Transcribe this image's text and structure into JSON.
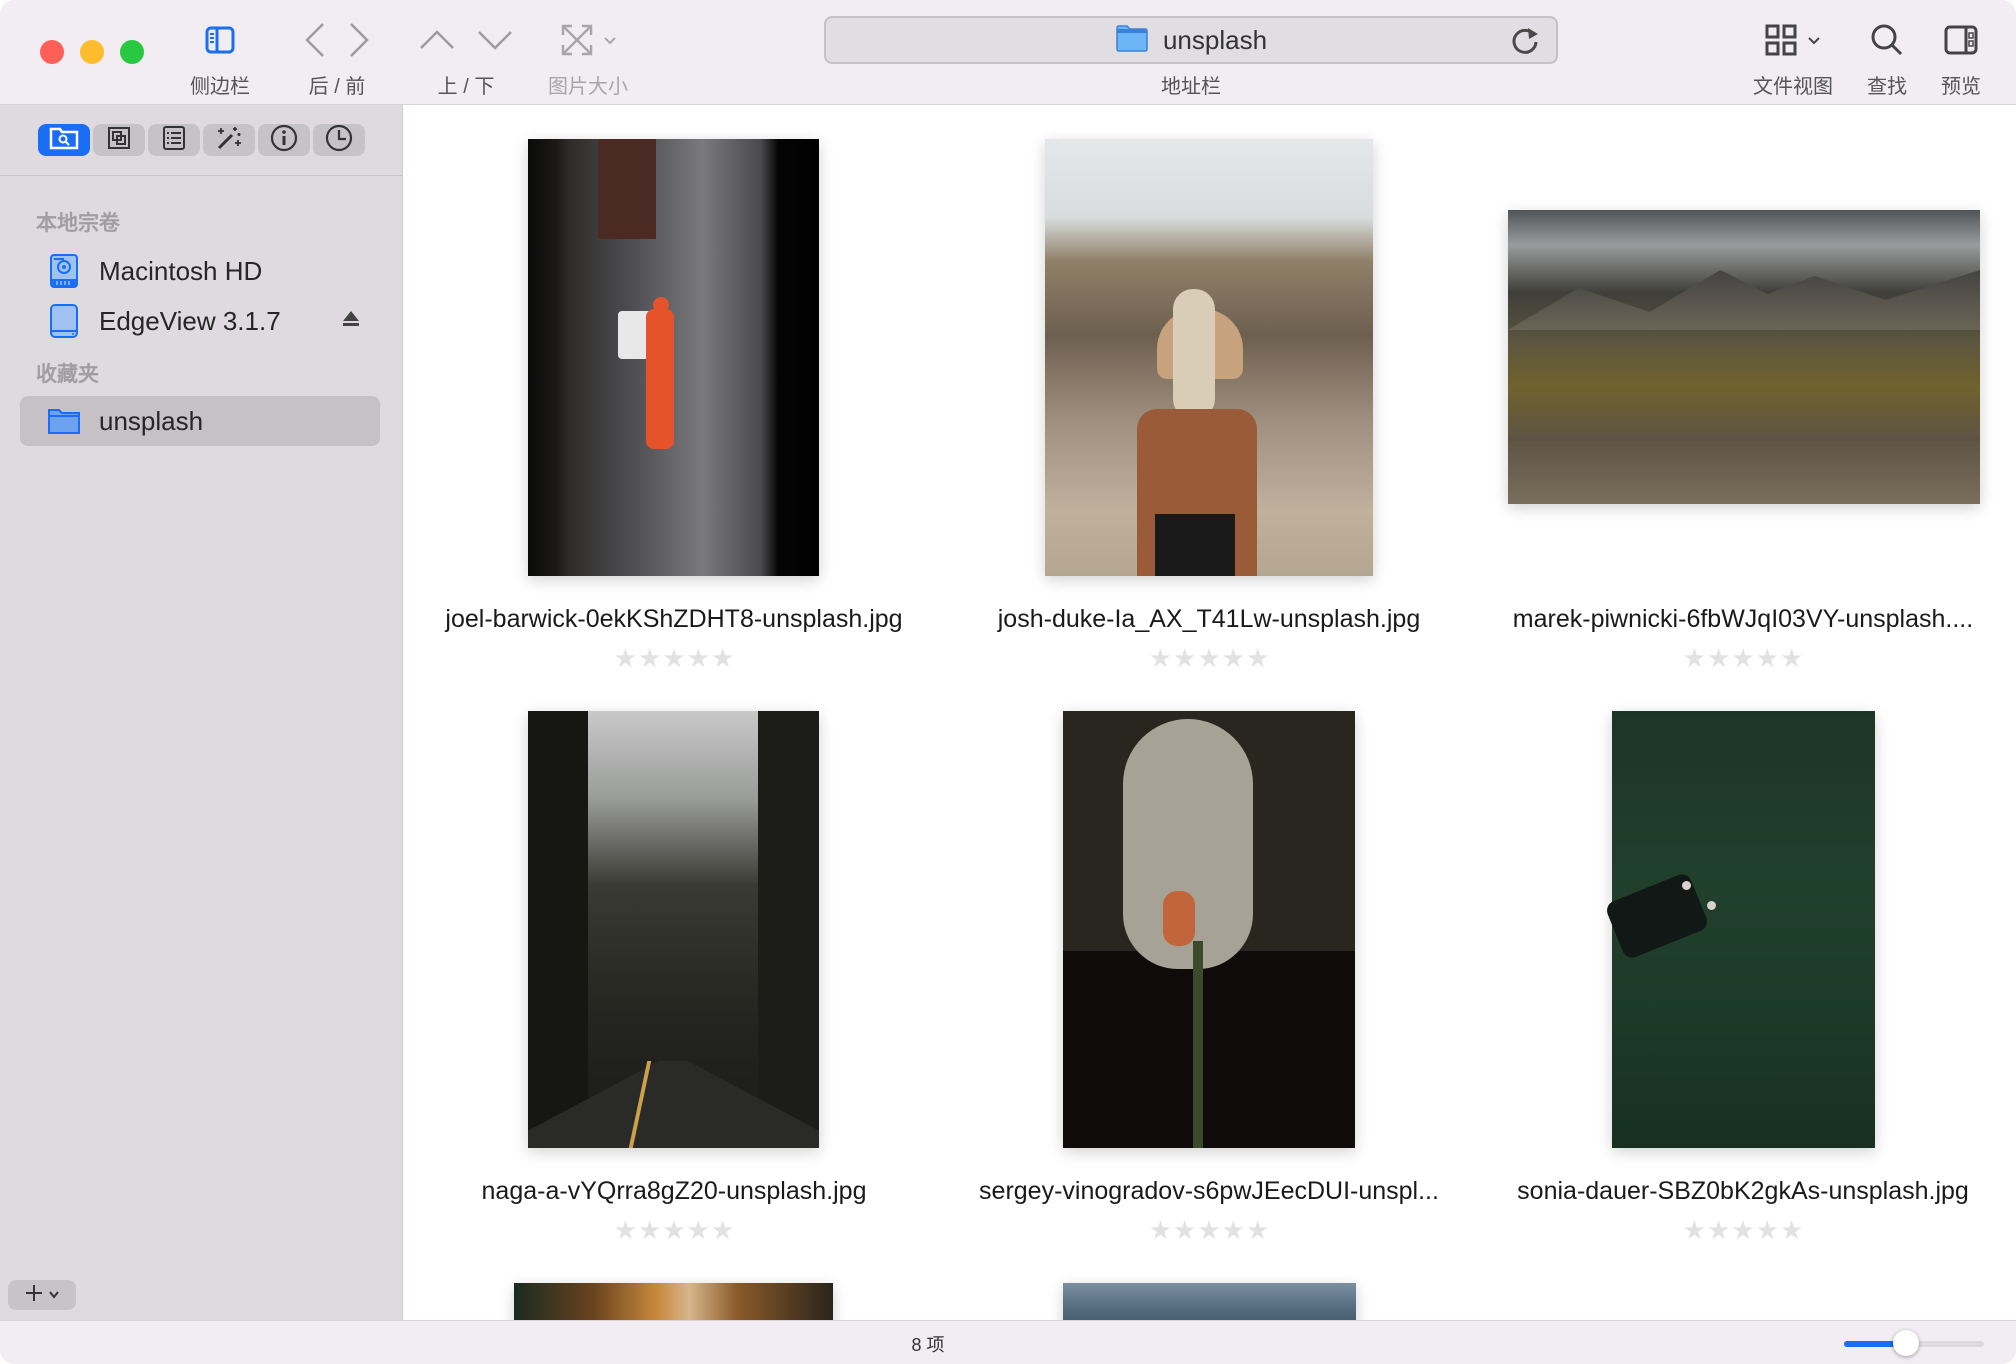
{
  "window": {
    "traffic_lights": {
      "close": "#fe5f57",
      "minimize": "#febc2e",
      "zoom": "#28c840"
    }
  },
  "toolbar": {
    "sidebar_label": "侧边栏",
    "back_forward_label": "后 / 前",
    "up_down_label": "上 / 下",
    "image_size_label": "图片大小",
    "address": {
      "path": "unsplash",
      "label": "地址栏"
    },
    "file_view_label": "文件视图",
    "find_label": "查找",
    "preview_label": "预览"
  },
  "sidebar": {
    "segments": [
      {
        "icon": "folder-search-icon",
        "active": true
      },
      {
        "icon": "layers-icon",
        "active": false
      },
      {
        "icon": "list-icon",
        "active": false
      },
      {
        "icon": "magic-wand-icon",
        "active": false
      },
      {
        "icon": "info-icon",
        "active": false
      },
      {
        "icon": "clock-icon",
        "active": false
      }
    ],
    "sections": [
      {
        "title": "本地宗卷",
        "items": [
          {
            "label": "Macintosh HD",
            "icon": "internal-drive-icon"
          },
          {
            "label": "EdgeView 3.1.7",
            "icon": "external-drive-icon",
            "ejectable": true
          }
        ]
      },
      {
        "title": "收藏夹",
        "items": [
          {
            "label": "unsplash",
            "icon": "folder-icon",
            "selected": true
          }
        ]
      }
    ],
    "add_button": "+"
  },
  "files": [
    {
      "name": "joel-barwick-0ekKShZDHT8-unsplash.jpg",
      "rating": 0
    },
    {
      "name": "josh-duke-Ia_AX_T41Lw-unsplash.jpg",
      "rating": 0
    },
    {
      "name": "marek-piwnicki-6fbWJqI03VY-unsplash....",
      "rating": 0
    },
    {
      "name": "naga-a-vYQrra8gZ20-unsplash.jpg",
      "rating": 0
    },
    {
      "name": "sergey-vinogradov-s6pwJEecDUI-unspl...",
      "rating": 0
    },
    {
      "name": "sonia-dauer-SBZ0bK2gkAs-unsplash.jpg",
      "rating": 0
    }
  ],
  "status": {
    "item_count": "8 项",
    "thumbnail_size_fraction": 0.44
  },
  "colors": {
    "accent": "#1a6ef5"
  }
}
